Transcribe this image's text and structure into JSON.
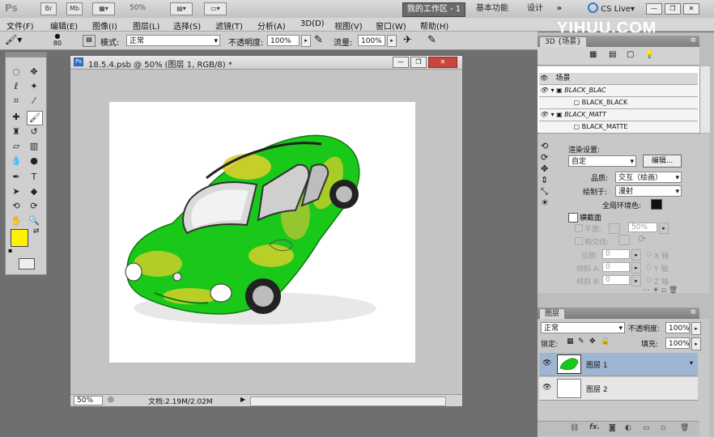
{
  "app": {
    "logo": "Ps",
    "zoom": "50%",
    "workspaces": [
      "我的工作区 - 1",
      "基本功能",
      "设计"
    ],
    "more": "»",
    "cslive": "CS Live",
    "watermark": "YIHUU.COM"
  },
  "menu": [
    "文件(F)",
    "编辑(E)",
    "图像(I)",
    "图层(L)",
    "选择(S)",
    "滤镜(T)",
    "分析(A)",
    "3D(D)",
    "视图(V)",
    "窗口(W)",
    "帮助(H)"
  ],
  "options": {
    "brush_size": "80",
    "mode_label": "模式:",
    "mode_value": "正常",
    "opacity_label": "不透明度:",
    "opacity_value": "100%",
    "flow_label": "流量:",
    "flow_value": "100%"
  },
  "document": {
    "title": "18.5.4.psb @ 50% (图层 1, RGB/8) *",
    "zoom": "50%",
    "doc_info": "文档:2.19M/2.02M"
  },
  "panel_3d": {
    "tab": "3D {场景}",
    "scene_header": "场景",
    "items": [
      {
        "label": "BLACK_BLAC",
        "type": "material-group"
      },
      {
        "label": "BLACK_BLACK",
        "type": "material"
      },
      {
        "label": "BLACK_MATT",
        "type": "material-group"
      },
      {
        "label": "BLACK_MATTE",
        "type": "material"
      }
    ],
    "render_settings_label": "渲染设置:",
    "render_settings_value": "自定",
    "edit_button": "编辑...",
    "quality_label": "品质:",
    "quality_value": "交互（绘画）",
    "paint_on_label": "绘制于:",
    "paint_on_value": "漫射",
    "ambient_label": "全局环境色:",
    "cross_section_label": "横截面",
    "plane_label": "平面:",
    "plane_value": "50%",
    "intersection_label": "相交线:",
    "offset_label": "位移:",
    "tilt_a_label": "倾斜 A:",
    "tilt_b_label": "倾斜 B:",
    "x_axis": "X 轴",
    "y_axis": "Y 轴",
    "z_axis": "Z 轴",
    "zero": "0"
  },
  "layers_panel": {
    "tab": "图层",
    "blend_mode": "正常",
    "opacity_label": "不透明度:",
    "opacity_value": "100%",
    "lock_label": "锁定:",
    "fill_label": "填充:",
    "fill_value": "100%",
    "layers": [
      {
        "name": "图层 1",
        "selected": true
      },
      {
        "name": "图层 2",
        "selected": false
      }
    ]
  },
  "colors": {
    "foreground": "#fff200",
    "background": "#ffffff",
    "car_green": "#19c818",
    "car_yellow": "#d8d12a",
    "ambient": "#111111"
  }
}
